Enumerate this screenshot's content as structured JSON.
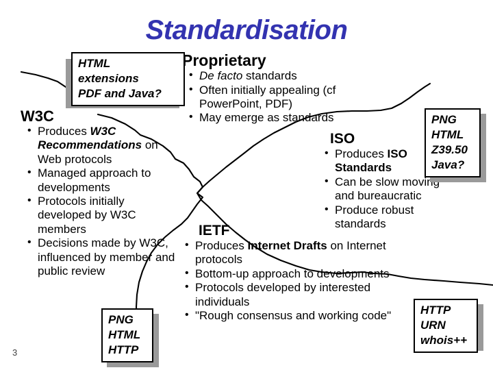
{
  "slide": {
    "title": "Standardisation",
    "title_color": "#3333b0",
    "number": "3",
    "background_color": "#ffffff"
  },
  "quadrants": [
    {
      "id": "w3c",
      "heading": "W3C",
      "bullets": [
        [
          {
            "t": "Produces ",
            "s": "plain"
          },
          {
            "t": "W3C Recommendations",
            "s": "bold-italic"
          },
          {
            "t": " on Web protocols",
            "s": "plain"
          }
        ],
        [
          {
            "t": "Managed approach to developments",
            "s": "plain"
          }
        ],
        [
          {
            "t": "Protocols initially developed by W3C members",
            "s": "plain"
          }
        ],
        [
          {
            "t": "Decisions made by W3C, influenced by member and public review",
            "s": "plain"
          }
        ]
      ]
    },
    {
      "id": "proprietary",
      "heading": "Proprietary",
      "bullets": [
        [
          {
            "t": "De facto",
            "s": "italic"
          },
          {
            "t": " standards",
            "s": "plain"
          }
        ],
        [
          {
            "t": "Often initially appealing (cf PowerPoint, PDF)",
            "s": "plain"
          }
        ],
        [
          {
            "t": "May emerge as standards",
            "s": "plain"
          }
        ]
      ]
    },
    {
      "id": "iso",
      "heading": "ISO",
      "bullets": [
        [
          {
            "t": "Produces ",
            "s": "plain"
          },
          {
            "t": "ISO Standards",
            "s": "bold"
          }
        ],
        [
          {
            "t": "Can be slow moving and bureaucratic",
            "s": "plain"
          }
        ],
        [
          {
            "t": "Produce robust standards",
            "s": "plain"
          }
        ]
      ]
    },
    {
      "id": "ietf",
      "heading": "IETF",
      "bullets": [
        [
          {
            "t": "Produces ",
            "s": "plain"
          },
          {
            "t": "Internet Drafts",
            "s": "bold"
          },
          {
            "t": " on Internet protocols",
            "s": "plain"
          }
        ],
        [
          {
            "t": "Bottom-up approach to developments",
            "s": "plain"
          }
        ],
        [
          {
            "t": "Protocols developed by interested individuals",
            "s": "plain"
          }
        ],
        [
          {
            "t": "\"Rough consensus and working code\"",
            "s": "plain"
          }
        ]
      ]
    }
  ],
  "callouts": [
    {
      "id": "html-extensions",
      "lines": [
        "HTML",
        "extensions",
        "PDF and Java?"
      ]
    },
    {
      "id": "png-html-z3950-java",
      "lines": [
        "PNG",
        "HTML",
        "Z39.50",
        "Java?"
      ]
    },
    {
      "id": "png-html-http",
      "lines": [
        "PNG",
        "HTML",
        "HTTP"
      ]
    },
    {
      "id": "http-urn-whois",
      "lines": [
        "HTTP",
        "URN",
        "whois++"
      ]
    }
  ],
  "colors": {
    "title": "#3333b0",
    "text": "#000000",
    "box_border": "#000000",
    "box_shadow": "#9a9a9a",
    "background": "#ffffff"
  }
}
